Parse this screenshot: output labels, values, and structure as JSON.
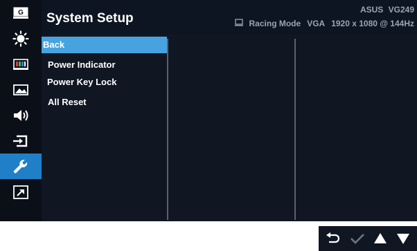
{
  "header": {
    "title": "System Setup",
    "brand": "ASUS",
    "model": "VG249",
    "mode": "Racing Mode",
    "input": "VGA",
    "resolution": "1920 x 1080 @ 144Hz"
  },
  "sidebar": {
    "items": [
      {
        "name": "GameVisual",
        "icon": "gamevisual-icon"
      },
      {
        "name": "Blue Light Filter",
        "icon": "brightness-icon"
      },
      {
        "name": "Color",
        "icon": "color-bars-icon"
      },
      {
        "name": "Image",
        "icon": "image-icon"
      },
      {
        "name": "Sound",
        "icon": "speaker-icon"
      },
      {
        "name": "Input Select",
        "icon": "input-icon"
      },
      {
        "name": "System Setup",
        "icon": "wrench-icon",
        "active": true
      },
      {
        "name": "MyFavorite",
        "icon": "shortcut-icon"
      }
    ]
  },
  "menu": {
    "items": [
      {
        "label": "Back",
        "selected": true
      },
      {
        "label": "Power Indicator"
      },
      {
        "label": "Power Key Lock"
      },
      {
        "label": "All Reset"
      }
    ]
  },
  "nav": {
    "buttons": [
      "back-icon",
      "check-icon",
      "up-icon",
      "down-icon"
    ]
  },
  "colors": {
    "background": "#101723",
    "accent": "#1f80c8",
    "selected": "#47a3e0",
    "text": "#ffffff",
    "muted": "#9aa4b2"
  }
}
